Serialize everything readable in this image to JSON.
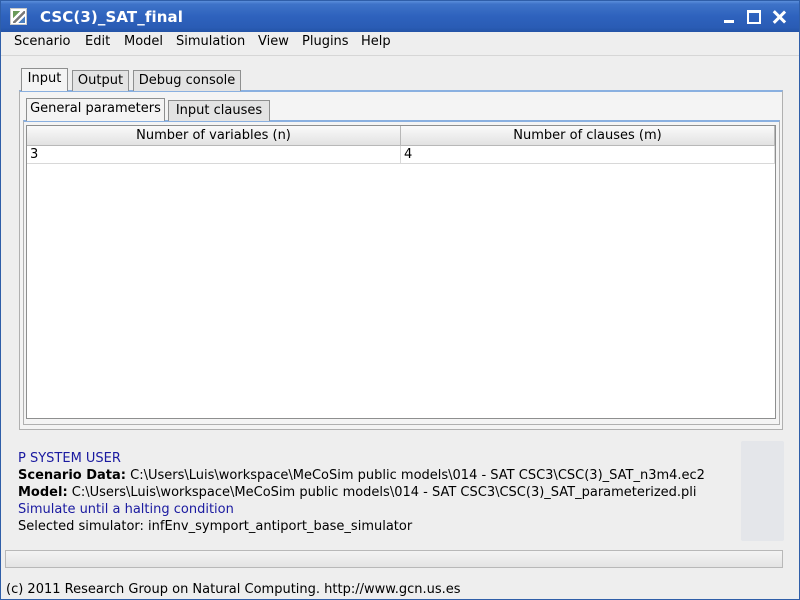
{
  "window": {
    "title": "CSC(3)_SAT_final"
  },
  "menu": [
    "Scenario",
    "Edit",
    "Model",
    "Simulation",
    "View",
    "Plugins",
    "Help"
  ],
  "main_tabs": [
    "Input",
    "Output",
    "Debug console"
  ],
  "sub_tabs": [
    "General parameters",
    "Input clauses"
  ],
  "table": {
    "columns": [
      "Number of variables (n)",
      "Number of clauses (m)"
    ],
    "rows": [
      [
        "3",
        "4"
      ]
    ]
  },
  "info": {
    "user": "P SYSTEM USER",
    "scenario_label": "Scenario Data:",
    "scenario_value": "C:\\Users\\Luis\\workspace\\MeCoSim public models\\014 - SAT CSC3\\CSC(3)_SAT_n3m4.ec2",
    "model_label": "Model:",
    "model_value": "C:\\Users\\Luis\\workspace\\MeCoSim public models\\014 - SAT CSC3\\CSC(3)_SAT_parameterized.pli",
    "simulate": "Simulate until a halting condition",
    "selected_simulator": "Selected simulator: infEnv_symport_antiport_base_simulator"
  },
  "footer": "(c) 2011 Research Group on Natural Computing. http://www.gcn.us.es",
  "colors": {
    "titlebar": "#2e62bd",
    "info_blue": "#1a1aa0"
  }
}
